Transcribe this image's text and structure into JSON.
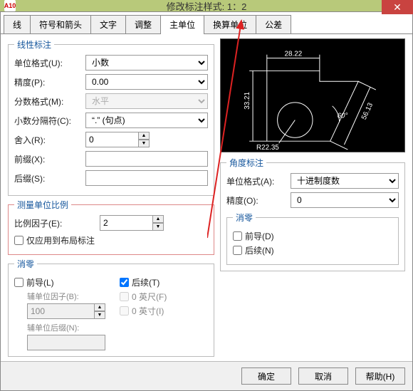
{
  "app_icon_text": "A10",
  "title": "修改标注样式: 1：2",
  "close_glyph": "✕",
  "tabs": [
    {
      "label": "线"
    },
    {
      "label": "符号和箭头"
    },
    {
      "label": "文字"
    },
    {
      "label": "调整"
    },
    {
      "label": "主单位"
    },
    {
      "label": "换算单位"
    },
    {
      "label": "公差"
    }
  ],
  "active_tab_index": 4,
  "linear": {
    "legend": "线性标注",
    "unit_format_label": "单位格式(U):",
    "unit_format_value": "小数",
    "precision_label": "精度(P):",
    "precision_value": "0.00",
    "fraction_label": "分数格式(M):",
    "fraction_value": "水平",
    "decimal_sep_label": "小数分隔符(C):",
    "decimal_sep_value": "“.” (句点)",
    "round_label": "舍入(R):",
    "round_value": "0",
    "prefix_label": "前缀(X):",
    "prefix_value": "",
    "suffix_label": "后缀(S):",
    "suffix_value": ""
  },
  "scale": {
    "legend": "测量单位比例",
    "factor_label": "比例因子(E):",
    "factor_value": "2",
    "apply_layout_label": "仅应用到布局标注"
  },
  "suppress": {
    "legend": "消零",
    "leading_label": "前导(L)",
    "trailing_label": "后续(T)",
    "trailing_checked": true,
    "subunit_factor_label": "辅单位因子(B):",
    "subunit_factor_value": "100",
    "subunit_suffix_label": "辅单位后缀(N):",
    "subunit_suffix_value": "",
    "feet_label": "0 英尺(F)",
    "inches_label": "0 英寸(I)"
  },
  "angular": {
    "legend": "角度标注",
    "unit_format_label": "单位格式(A):",
    "unit_format_value": "十进制度数",
    "precision_label": "精度(O):",
    "precision_value": "0",
    "suppress_legend": "消零",
    "leading_label": "前导(D)",
    "trailing_label": "后续(N)"
  },
  "preview_dims": {
    "d1": "28.22",
    "d2": "33.21",
    "d3": "56.13",
    "angle": "60°",
    "radius": "R22.35"
  },
  "buttons": {
    "ok": "确定",
    "cancel": "取消",
    "help": "帮助(H)"
  }
}
